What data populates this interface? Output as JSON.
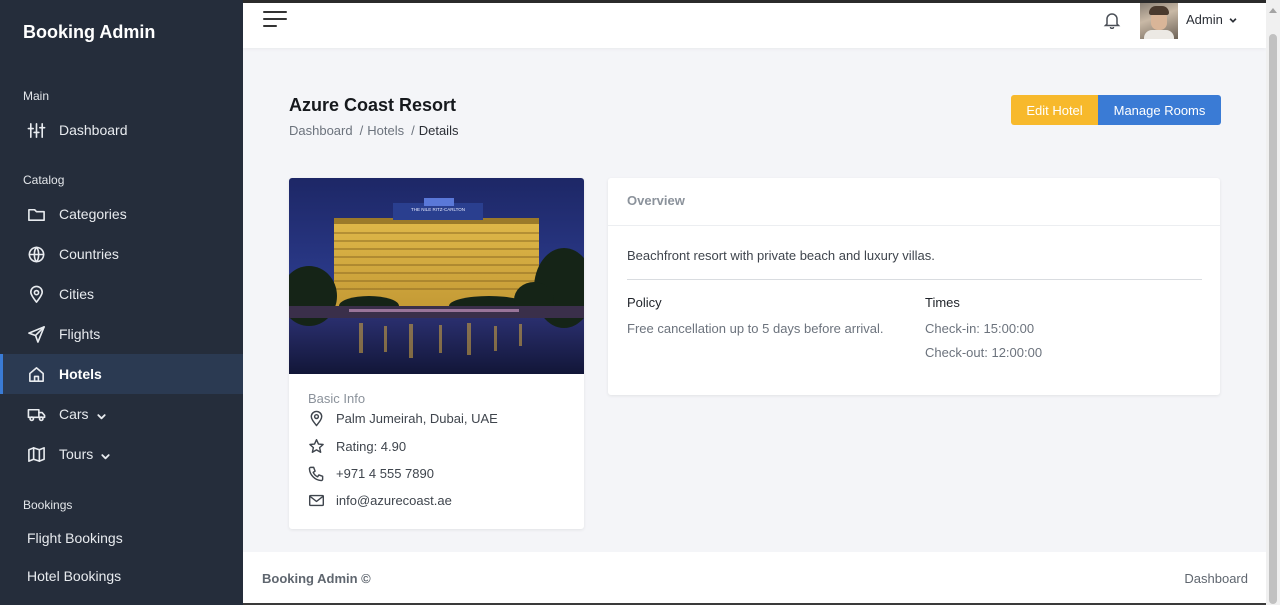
{
  "sidebar": {
    "brand": "Booking Admin",
    "sections": {
      "main": "Main",
      "catalog": "Catalog",
      "bookings": "Bookings"
    },
    "items": {
      "dashboard": "Dashboard",
      "categories": "Categories",
      "countries": "Countries",
      "cities": "Cities",
      "flights": "Flights",
      "hotels": "Hotels",
      "cars": "Cars",
      "tours": "Tours",
      "flight_bookings": "Flight Bookings",
      "hotel_bookings": "Hotel Bookings"
    },
    "active_item": "hotels"
  },
  "topbar": {
    "user_name": "Admin"
  },
  "page": {
    "title": "Azure Coast Resort",
    "breadcrumb": [
      "Dashboard",
      "Hotels",
      "Details"
    ],
    "buttons": {
      "edit": "Edit Hotel",
      "rooms": "Manage Rooms"
    }
  },
  "hotel_card": {
    "basic_info_title": "Basic Info",
    "location": "Palm Jumeirah, Dubai, UAE",
    "rating": "Rating: 4.90",
    "phone": "+971 4 555 7890",
    "email": "info@azurecoast.ae",
    "image_sign": "THE NILE RITZ-CARLTON"
  },
  "overview": {
    "title": "Overview",
    "description": "Beachfront resort with private beach and luxury villas.",
    "policy_label": "Policy",
    "policy_text": "Free cancellation up to 5 days before arrival.",
    "times_label": "Times",
    "check_in": "Check-in: 15:00:00",
    "check_out": "Check-out: 12:00:00"
  },
  "footer": {
    "brand": "Booking Admin ©",
    "link": "Dashboard"
  },
  "colors": {
    "sidebar_bg": "#252d3b",
    "accent_blue": "#3a7bd5",
    "accent_yellow": "#f7b92c",
    "page_bg": "#f4f5f8"
  }
}
